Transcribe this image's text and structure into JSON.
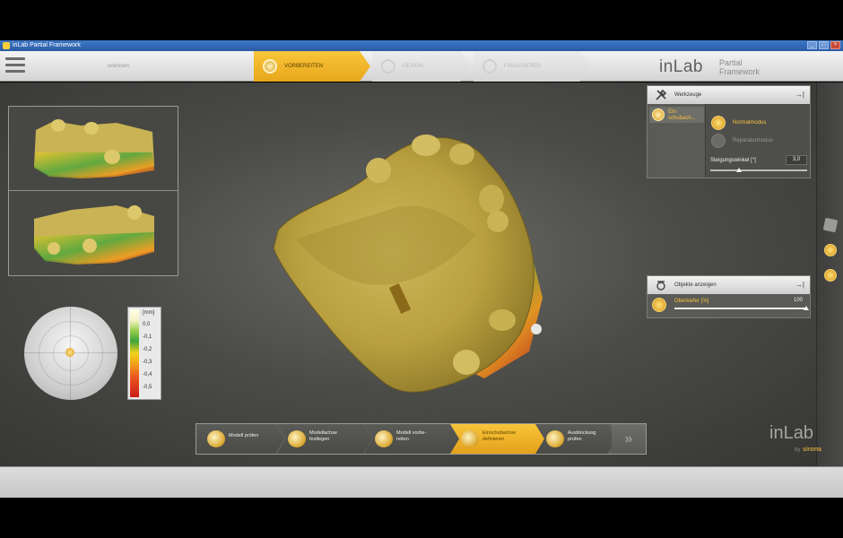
{
  "window": {
    "title": "inLab Partial Framework",
    "buttons": [
      "_",
      "□",
      "×"
    ]
  },
  "header": {
    "menu_icon": "hamburger-icon",
    "patient_name": "unknown",
    "phases": [
      {
        "label": "VORBEREITEN",
        "active": true
      },
      {
        "label": "DESIGN",
        "active": false
      },
      {
        "label": "FINALISIEREN",
        "active": false
      }
    ],
    "logo": {
      "brand": "inLab",
      "line1": "Partial",
      "line2": "Framework"
    }
  },
  "tools_panel": {
    "title": "Werkzeuge",
    "pin": "→|",
    "selected_tool": "Ein-\nschubach...",
    "modes": [
      {
        "label": "Normalmodus",
        "active": true
      },
      {
        "label": "Reparaturmodus",
        "active": false
      }
    ],
    "slope_label": "Steigungswinkel  [°]",
    "slope_value": "3,0",
    "slope_fraction": 0.27
  },
  "objects_panel": {
    "title": "Objekte anzeigen",
    "pin": "→|",
    "item_label": "Oberkiefer  [%]",
    "item_value": "100",
    "opacity_fraction": 1.0
  },
  "color_scale": {
    "unit": "[mm]",
    "labels": [
      "0,0",
      "-0,1",
      "-0,2",
      "-0,3",
      "-0,4",
      "-0,5"
    ],
    "colors": [
      "#f7f4c8",
      "#3ea43a",
      "#f2d31b",
      "#f3a21a",
      "#ea5a1e",
      "#cc1a1a"
    ]
  },
  "workflow": {
    "steps": [
      {
        "label_1": "Modell prüfen",
        "label_2": "",
        "active": false
      },
      {
        "label_1": "Modellachse",
        "label_2": "festlegen",
        "active": false
      },
      {
        "label_1": "Modell vorbe-",
        "label_2": "reiten",
        "active": false
      },
      {
        "label_1": "Einschubachse",
        "label_2": "definieren",
        "active": true
      },
      {
        "label_1": "Ausblockung",
        "label_2": "prüfen",
        "active": false
      }
    ],
    "next": "»"
  },
  "footer_logo": {
    "brand": "inLab",
    "by": "by",
    "company": "sirona"
  },
  "accent_color": "#f2b52a"
}
